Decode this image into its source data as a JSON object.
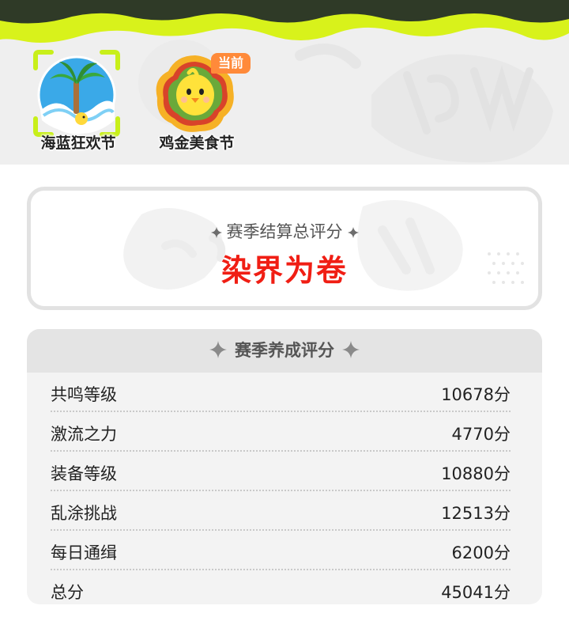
{
  "seasons": [
    {
      "name": "海蓝狂欢节",
      "selected": true
    },
    {
      "name": "鸡金美食节",
      "current": true
    }
  ],
  "current_badge": "当前",
  "summary": {
    "heading": "赛季结算总评分",
    "rating": "染界为卷"
  },
  "training": {
    "heading": "赛季养成评分",
    "rows": [
      {
        "label": "共鸣等级",
        "value": "10678分"
      },
      {
        "label": "激流之力",
        "value": "4770分"
      },
      {
        "label": "装备等级",
        "value": "10880分"
      },
      {
        "label": "乱涂挑战",
        "value": "12513分"
      },
      {
        "label": "每日通缉",
        "value": "6200分"
      },
      {
        "label": "总分",
        "value": "45041分"
      }
    ]
  },
  "colors": {
    "accent_lime": "#d8f21b",
    "rating_red": "#f01e14",
    "badge_orange": "#ff8a3a"
  },
  "icons": [
    "palm-wave-season-icon",
    "chick-season-icon",
    "diamond-sparkle-icon"
  ]
}
